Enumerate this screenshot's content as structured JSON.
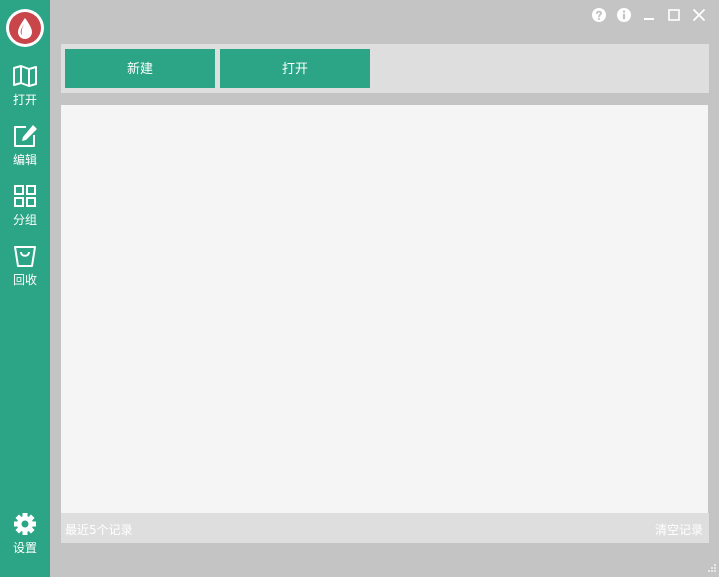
{
  "app": {
    "logo": "droplet-icon",
    "accent": "#2ba585",
    "logo_color": "#c8454a"
  },
  "sidebar": {
    "items": [
      {
        "label": "打开",
        "icon": "map-book-icon"
      },
      {
        "label": "编辑",
        "icon": "edit-icon"
      },
      {
        "label": "分组",
        "icon": "grid-icon"
      },
      {
        "label": "回收",
        "icon": "recycle-bag-icon"
      }
    ],
    "settings": {
      "label": "设置",
      "icon": "gear-icon"
    }
  },
  "window_controls": [
    "help-icon",
    "info-icon",
    "minimize-icon",
    "maximize-icon",
    "close-icon"
  ],
  "toolbar": {
    "new_label": "新建",
    "open_label": "打开"
  },
  "footer": {
    "recent_label": "最近5个记录",
    "clear_label": "清空记录"
  }
}
